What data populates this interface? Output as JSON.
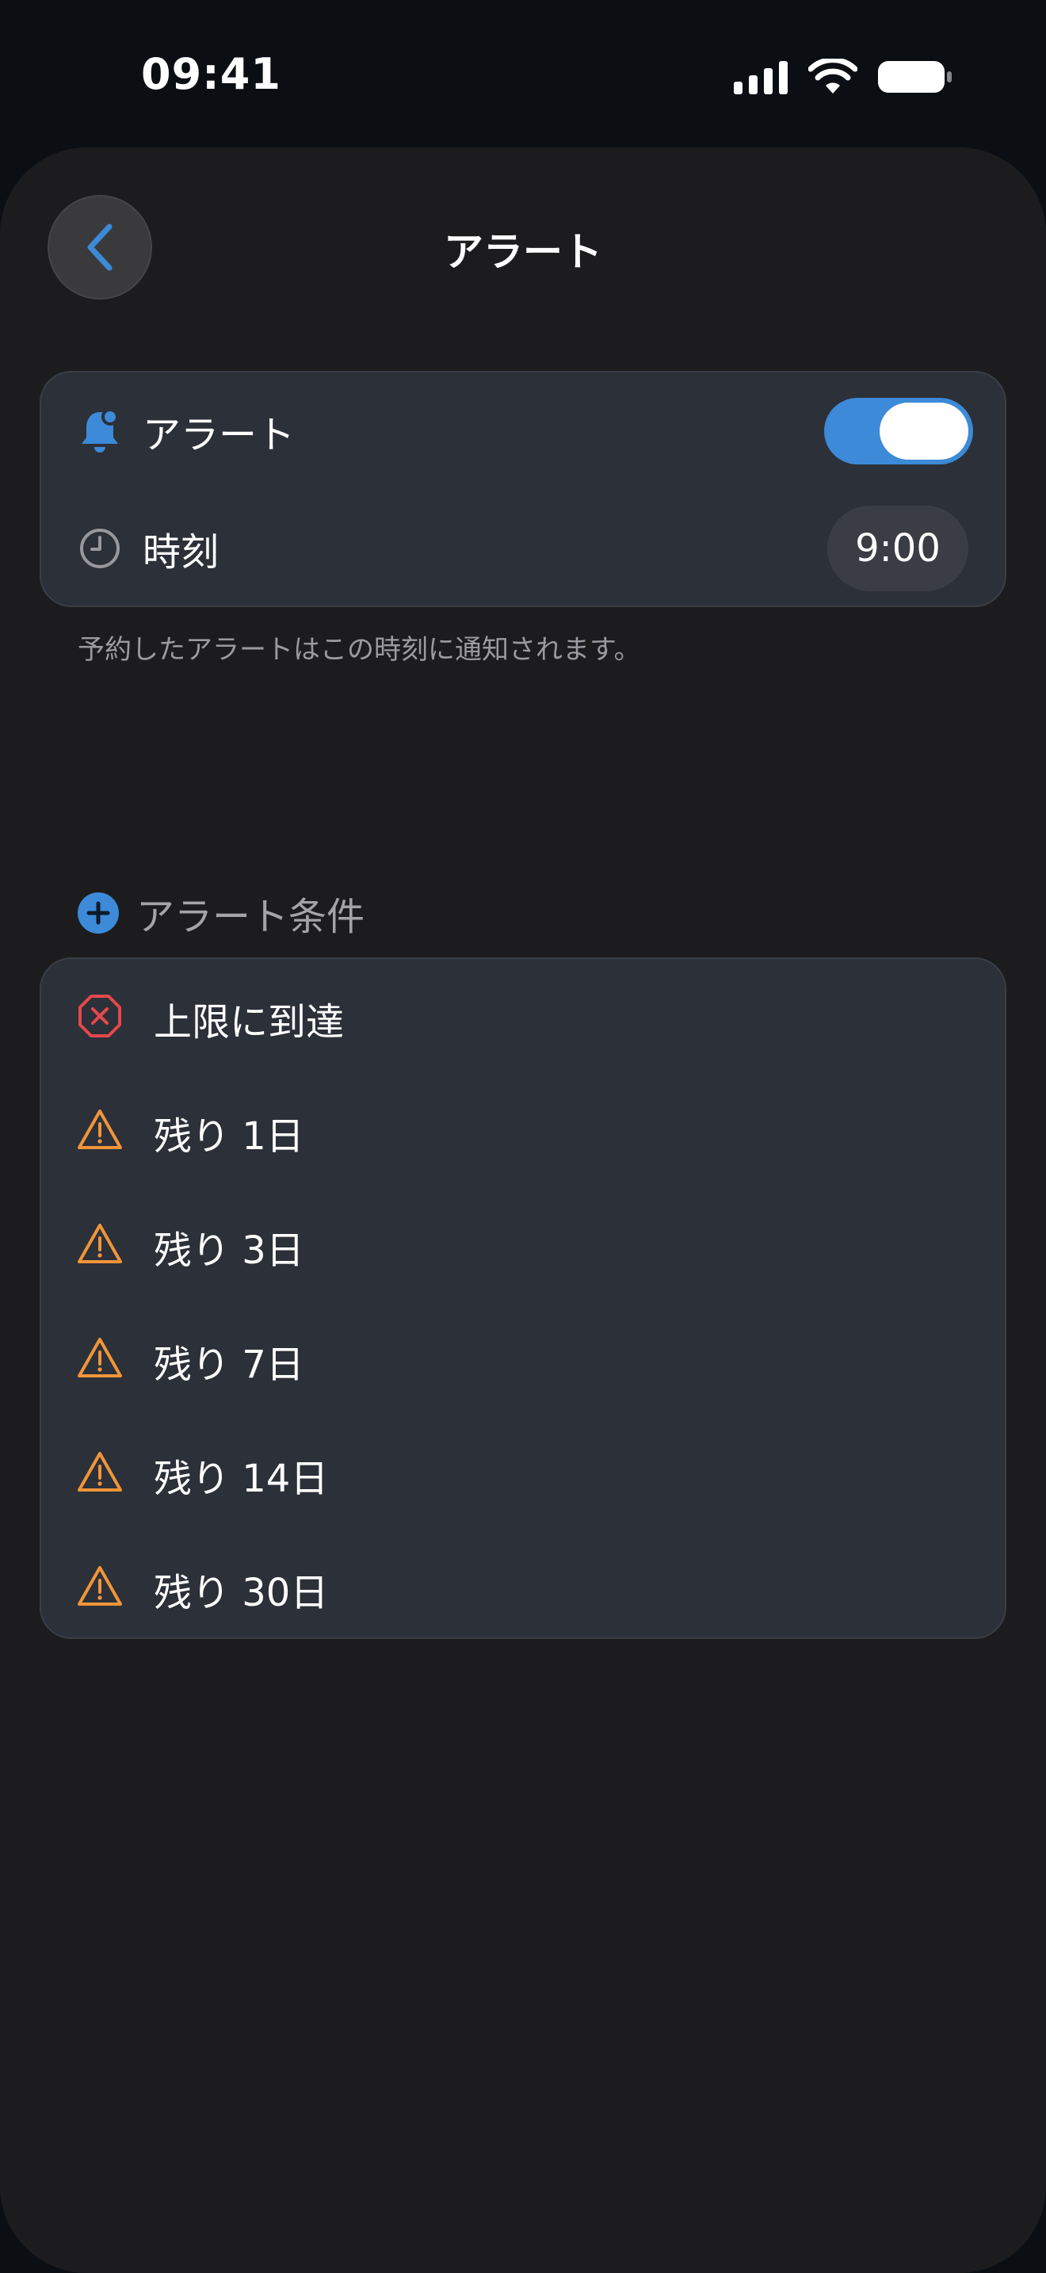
{
  "status_bar": {
    "time": "09:41"
  },
  "nav": {
    "title": "アラート"
  },
  "alert_settings": {
    "alert_label": "アラート",
    "alert_enabled": true,
    "time_label": "時刻",
    "time_value": "9:00",
    "footnote": "予約したアラートはこの時刻に通知されます。"
  },
  "conditions": {
    "header": "アラート条件",
    "items": [
      {
        "label": "上限に到達",
        "icon": "x-octagon-icon"
      },
      {
        "label": "残り 1日",
        "icon": "warning-icon"
      },
      {
        "label": "残り 3日",
        "icon": "warning-icon"
      },
      {
        "label": "残り 7日",
        "icon": "warning-icon"
      },
      {
        "label": "残り 14日",
        "icon": "warning-icon"
      },
      {
        "label": "残り 30日",
        "icon": "warning-icon"
      }
    ]
  },
  "colors": {
    "accent": "#3c8ad8",
    "danger": "#e5484d",
    "warning": "#f0953a",
    "background": "#1c1c1e",
    "card": "#2c3038"
  }
}
